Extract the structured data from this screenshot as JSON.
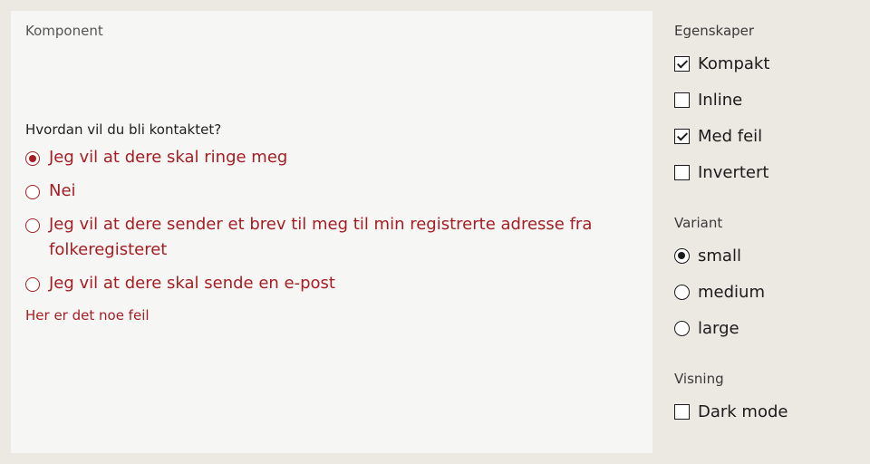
{
  "component_panel": {
    "label": "Komponent",
    "radio_group": {
      "legend": "Hvordan vil du bli kontaktet?",
      "options": [
        {
          "label": "Jeg vil at dere skal ringe meg",
          "checked": true
        },
        {
          "label": "Nei",
          "checked": false
        },
        {
          "label": "Jeg vil at dere sender et brev til meg til min registrerte adresse fra folkeregisteret",
          "checked": false
        },
        {
          "label": "Jeg vil at dere skal sende en e-post",
          "checked": false
        }
      ],
      "error_message": "Her er det noe feil"
    }
  },
  "sidebar": {
    "properties": {
      "heading": "Egenskaper",
      "options": [
        {
          "label": "Kompakt",
          "checked": true
        },
        {
          "label": "Inline",
          "checked": false
        },
        {
          "label": "Med feil",
          "checked": true
        },
        {
          "label": "Invertert",
          "checked": false
        }
      ]
    },
    "variant": {
      "heading": "Variant",
      "options": [
        {
          "label": "small",
          "checked": true
        },
        {
          "label": "medium",
          "checked": false
        },
        {
          "label": "large",
          "checked": false
        }
      ]
    },
    "display": {
      "heading": "Visning",
      "options": [
        {
          "label": "Dark mode",
          "checked": false
        }
      ]
    }
  },
  "colors": {
    "error_red": "#a41e24",
    "page_background": "#ece8e2",
    "panel_background": "#f6f6f5"
  }
}
